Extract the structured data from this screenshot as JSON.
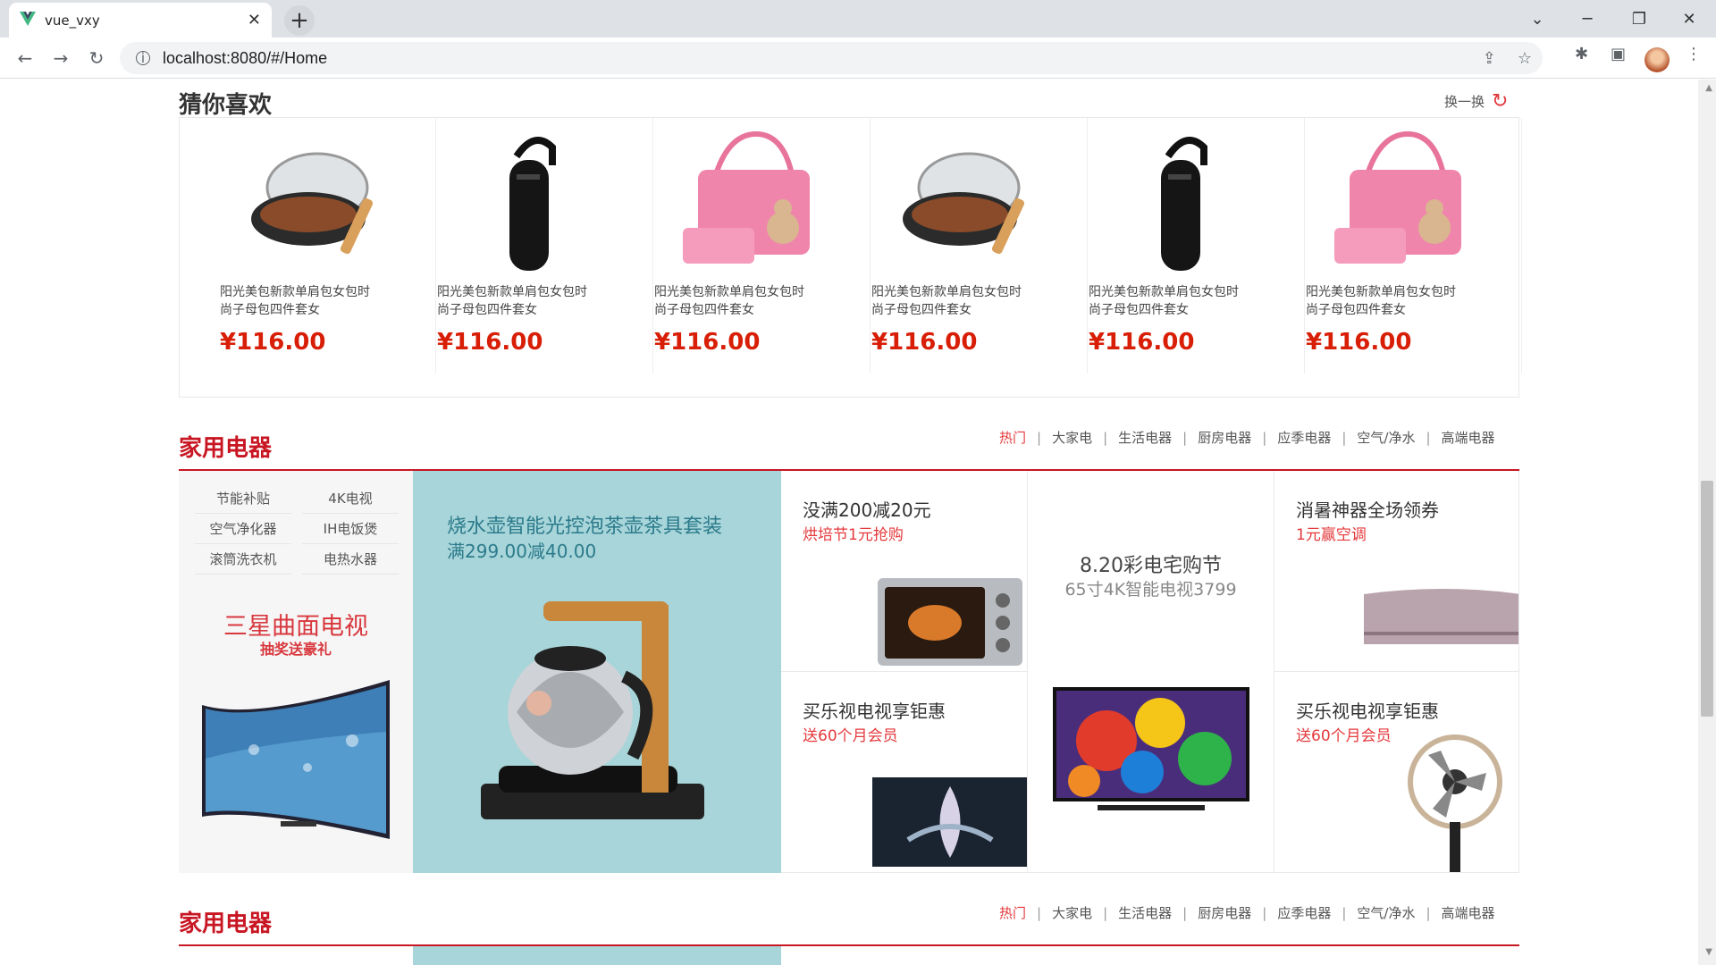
{
  "browser": {
    "tab_title": "vue_vxy",
    "url": "localhost:8080/#/Home"
  },
  "guess": {
    "title": "猜你喜欢",
    "refresh": "换一换",
    "items": [
      {
        "name": "阳光美包新款单肩包女包时尚子母包四件套女",
        "price": "¥116.00",
        "icon": "wok-pan"
      },
      {
        "name": "阳光美包新款单肩包女包时尚子母包四件套女",
        "price": "¥116.00",
        "icon": "bluetooth-headset"
      },
      {
        "name": "阳光美包新款单肩包女包时尚子母包四件套女",
        "price": "¥116.00",
        "icon": "pink-handbag"
      },
      {
        "name": "阳光美包新款单肩包女包时尚子母包四件套女",
        "price": "¥116.00",
        "icon": "wok-pan"
      },
      {
        "name": "阳光美包新款单肩包女包时尚子母包四件套女",
        "price": "¥116.00",
        "icon": "bluetooth-headset"
      },
      {
        "name": "阳光美包新款单肩包女包时尚子母包四件套女",
        "price": "¥116.00",
        "icon": "pink-handbag"
      }
    ]
  },
  "section1": {
    "title": "家用电器",
    "tabs": [
      "热门",
      "大家电",
      "生活电器",
      "厨房电器",
      "应季电器",
      "空气/净水",
      "高端电器"
    ],
    "keywords": [
      "节能补贴",
      "4K电视",
      "空气净化器",
      "IH电饭煲",
      "滚筒洗衣机",
      "电热水器"
    ],
    "left_promo": {
      "title": "三星曲面电视",
      "sub": "抽奖送豪礼"
    },
    "mid_promo": {
      "title": "烧水壶智能光控泡茶壶茶具套装",
      "sub": "满299.00减40.00"
    },
    "cells": [
      {
        "title": "没满200减20元",
        "sub": "烘培节1元抢购"
      },
      {
        "title": "8.20彩电宅购节",
        "sub": "65寸4K智能电视3799"
      },
      {
        "title": "消暑神器全场领券",
        "sub": "1元赢空调"
      },
      {
        "title": "买乐视电视享钜惠",
        "sub": "送60个月会员"
      },
      {
        "title": "买乐视电视享钜惠",
        "sub": "送60个月会员"
      }
    ]
  },
  "section2": {
    "title": "家用电器",
    "tabs": [
      "热门",
      "大家电",
      "生活电器",
      "厨房电器",
      "应季电器",
      "空气/净水",
      "高端电器"
    ]
  }
}
